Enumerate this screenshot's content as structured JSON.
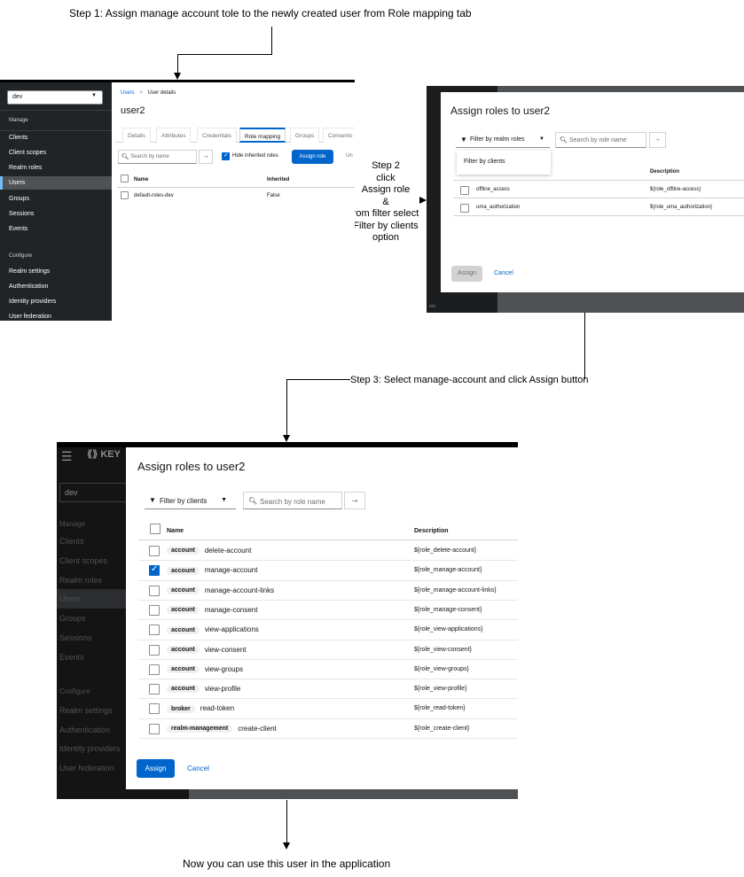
{
  "annotations": {
    "step1": "Step 1: Assign manage account tole to the newly created user from Role mapping tab",
    "step2_lines": [
      "Step 2",
      "click",
      "Assign  role",
      "&",
      "rom filter select",
      "Filter by clients",
      "option"
    ],
    "step3": "Step 3: Select manage-account and click Assign button",
    "final": "Now you can use this user in the application"
  },
  "shot1": {
    "realm_select": "dev",
    "sidebar": {
      "section_manage": "Manage",
      "items_manage": [
        "Clients",
        "Client scopes",
        "Realm roles",
        "Users",
        "Groups",
        "Sessions",
        "Events"
      ],
      "section_configure": "Configure",
      "items_configure": [
        "Realm settings",
        "Authentication",
        "Identity providers",
        "User federation"
      ]
    },
    "breadcrumb": {
      "root": "Users",
      "sep": ">",
      "current": "User details"
    },
    "title": "user2",
    "tabs": [
      "Details",
      "Attributes",
      "Credentials",
      "Role mapping",
      "Groups",
      "Consents"
    ],
    "toolbar": {
      "search_placeholder": "Search by name",
      "hide_inherited": "Hide inherited roles",
      "assign_role": "Assign role",
      "unassign_partial": "Un"
    },
    "table": {
      "headers": [
        "Name",
        "Inherited"
      ],
      "rows": [
        {
          "name": "default-roles-dev",
          "inherited": "False"
        }
      ]
    }
  },
  "shot2": {
    "title": "Assign roles to user2",
    "filter_label": "Filter by realm roles",
    "dropdown_option": "Filter by clients",
    "search_placeholder": "Search by role name",
    "desc_header": "Description",
    "rows": [
      {
        "name": "offline_access",
        "description": "${role_offline-access}"
      },
      {
        "name": "uma_authorization",
        "description": "${role_uma_authorization}"
      }
    ],
    "assign": "Assign",
    "cancel": "Cancel",
    "bg_fragment": "ers"
  },
  "shot3": {
    "brand_partial": "KEY",
    "realm_select": "dev",
    "sidebar": {
      "section_manage": "Manage",
      "items_manage": [
        "Clients",
        "Client scopes",
        "Realm roles",
        "Users",
        "Groups",
        "Sessions",
        "Events"
      ],
      "section_configure": "Configure",
      "items_configure": [
        "Realm settings",
        "Authentication",
        "Identity providers",
        "User federation"
      ]
    },
    "title": "Assign roles to user2",
    "filter_label": "Filter by clients",
    "search_placeholder": "Search by role name",
    "headers": [
      "Name",
      "Description"
    ],
    "rows": [
      {
        "client": "account",
        "role": "delete-account",
        "description": "${role_delete-account}",
        "checked": false
      },
      {
        "client": "account",
        "role": "manage-account",
        "description": "${role_manage-account}",
        "checked": true
      },
      {
        "client": "account",
        "role": "manage-account-links",
        "description": "${role_manage-account-links}",
        "checked": false
      },
      {
        "client": "account",
        "role": "manage-consent",
        "description": "${role_manage-consent}",
        "checked": false
      },
      {
        "client": "account",
        "role": "view-applications",
        "description": "${role_view-applications}",
        "checked": false
      },
      {
        "client": "account",
        "role": "view-consent",
        "description": "${role_view-consent}",
        "checked": false
      },
      {
        "client": "account",
        "role": "view-groups",
        "description": "${role_view-groups}",
        "checked": false
      },
      {
        "client": "account",
        "role": "view-profile",
        "description": "${role_view-profile}",
        "checked": false
      },
      {
        "client": "broker",
        "role": "read-token",
        "description": "${role_read-token}",
        "checked": false
      },
      {
        "client": "realm-management",
        "role": "create-client",
        "description": "${role_create-client}",
        "checked": false
      }
    ],
    "assign": "Assign",
    "cancel": "Cancel"
  },
  "colors": {
    "primary": "#0066cc",
    "sidebar_bg": "#212427",
    "sidebar_active": "#4f5255"
  }
}
